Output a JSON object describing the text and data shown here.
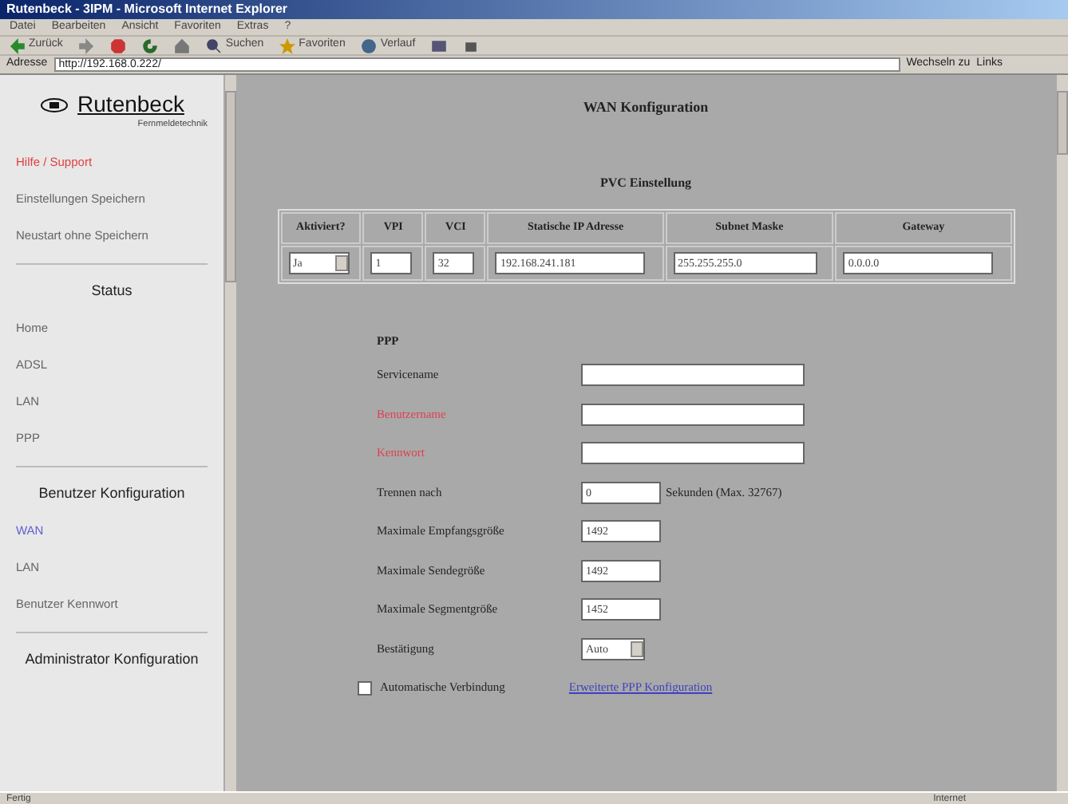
{
  "window": {
    "title": "Rutenbeck - 3IPM - Microsoft Internet Explorer"
  },
  "menu": [
    "Datei",
    "Bearbeiten",
    "Ansicht",
    "Favoriten",
    "Extras",
    "?"
  ],
  "toolbar": [
    {
      "label": "Zurück",
      "kind": "back"
    },
    {
      "kind": "forward"
    },
    {
      "kind": "stop"
    },
    {
      "kind": "refresh"
    },
    {
      "kind": "home"
    },
    {
      "label": "Suchen",
      "kind": "search"
    },
    {
      "label": "Favoriten",
      "kind": "favorites"
    },
    {
      "label": "Verlauf",
      "kind": "history"
    },
    {
      "kind": "mail"
    },
    {
      "kind": "print"
    }
  ],
  "address": {
    "label": "Adresse",
    "value": "http://192.168.0.222/",
    "go": "Wechseln zu",
    "links": "Links"
  },
  "sidebar": {
    "logo": "Rutenbeck",
    "tagline": "Fernmeldetechnik",
    "sections": [
      {
        "items": [
          {
            "label": "Hilfe / Support",
            "kind": "help"
          },
          {
            "label": "Einstellungen Speichern",
            "kind": "link"
          },
          {
            "label": "Neustart ohne Speichern",
            "kind": "link"
          }
        ]
      },
      {
        "heading": "Status",
        "items": [
          {
            "label": "Home",
            "kind": "link"
          },
          {
            "label": "ADSL",
            "kind": "link"
          },
          {
            "label": "LAN",
            "kind": "link"
          },
          {
            "label": "PPP",
            "kind": "link"
          }
        ]
      },
      {
        "heading": "Benutzer Konfiguration",
        "items": [
          {
            "label": "WAN",
            "kind": "visited"
          },
          {
            "label": "LAN",
            "kind": "link"
          },
          {
            "label": "Benutzer Kennwort",
            "kind": "link"
          }
        ]
      },
      {
        "heading": "Administrator Konfiguration"
      }
    ]
  },
  "page": {
    "title": "WAN Konfiguration",
    "pvc_title": "PVC Einstellung",
    "table": {
      "columns": [
        "Aktiviert?",
        "VPI",
        "VCI",
        "Statische IP Adresse",
        "Subnet Maske",
        "Gateway"
      ],
      "row": [
        {
          "kind": "select",
          "value": "Ja"
        },
        {
          "kind": "input",
          "value": "1"
        },
        {
          "kind": "input",
          "value": "32"
        },
        {
          "kind": "input",
          "value": "192.168.241.181"
        },
        {
          "kind": "input",
          "value": "255.255.255.0"
        },
        {
          "kind": "input",
          "value": "0.0.0.0"
        }
      ]
    },
    "ppp_title": "PPP",
    "fields": [
      {
        "label": "Servicename",
        "kind": "wide",
        "required": false
      },
      {
        "label": "Benutzername",
        "kind": "wide",
        "required": true
      },
      {
        "label": "Kennwort",
        "kind": "wide",
        "required": true
      },
      {
        "label": "Trennen nach",
        "kind": "short",
        "value": "0",
        "unit": "Sekunden (Max. 32767)",
        "required": false
      },
      {
        "label": "Maximale Empfangsgröße",
        "kind": "short",
        "value": "1492",
        "required": false
      },
      {
        "label": "Maximale Sendegröße",
        "kind": "short",
        "value": "1492",
        "required": false
      },
      {
        "label": "Maximale Segmentgröße",
        "kind": "short",
        "value": "1452",
        "required": false
      },
      {
        "label": "Bestätigung",
        "kind": "select",
        "value": "Auto",
        "required": false
      }
    ],
    "auto_connect": {
      "label": "Automatische Verbindung",
      "checked": false
    },
    "advanced_link": "Erweiterte PPP Konfiguration"
  },
  "status_bar": {
    "text": "Fertig",
    "zone": "Internet"
  }
}
